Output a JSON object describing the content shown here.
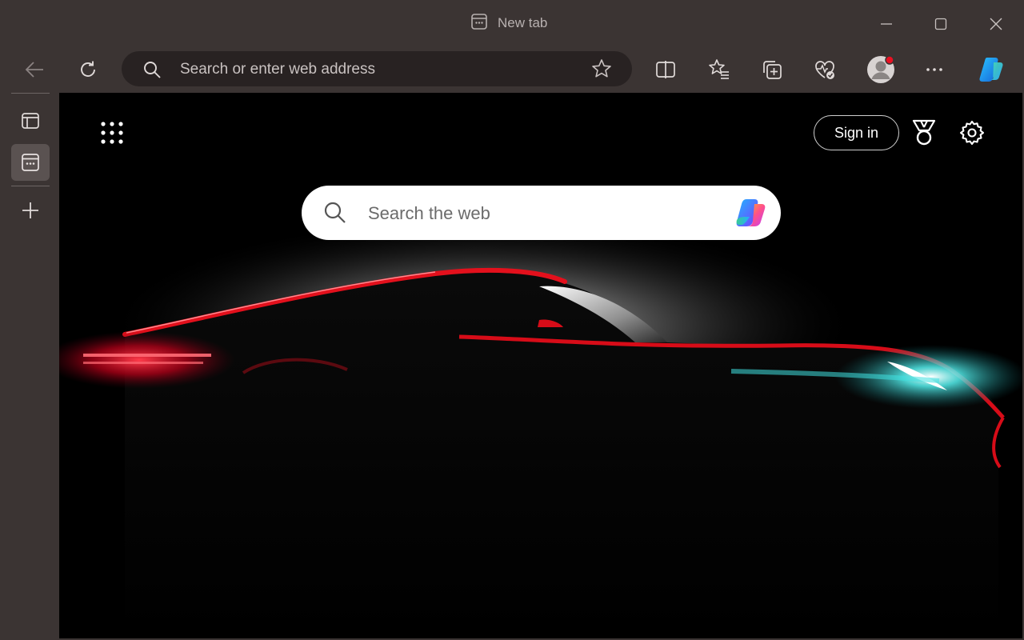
{
  "window": {
    "tab_title": "New tab",
    "minimize_icon": "minimize-icon",
    "maximize_icon": "maximize-icon",
    "close_icon": "close-icon"
  },
  "toolbar": {
    "back_icon": "back-arrow-icon",
    "refresh_icon": "refresh-icon",
    "address_placeholder": "Search or enter web address",
    "favorite_icon": "star-icon",
    "split_screen_icon": "split-screen-icon",
    "favorites_icon": "favorites-list-icon",
    "collections_icon": "collections-icon",
    "browser_essentials_icon": "heart-pulse-icon",
    "profile_icon": "profile-avatar-icon",
    "more_icon": "ellipsis-icon",
    "copilot_icon": "copilot-icon"
  },
  "siderail": {
    "items": [
      {
        "name": "tab-actions",
        "icon": "tab-actions-icon"
      },
      {
        "name": "new-tab",
        "icon": "new-tab-page-icon",
        "active": true
      },
      {
        "name": "add",
        "icon": "plus-icon"
      }
    ]
  },
  "newtab": {
    "apps_icon": "app-launcher-icon",
    "sign_in_label": "Sign in",
    "rewards_icon": "rewards-medal-icon",
    "settings_icon": "gear-icon",
    "search_placeholder": "Search the web",
    "search_icon": "search-icon",
    "copilot_icon": "copilot-icon"
  },
  "colors": {
    "frame": "#3b3433",
    "address_bg": "#282222",
    "content_bg": "#000000",
    "accent_red": "#e3101c",
    "accent_cyan": "#3fe0e0",
    "profile_badge": "#e81123"
  }
}
